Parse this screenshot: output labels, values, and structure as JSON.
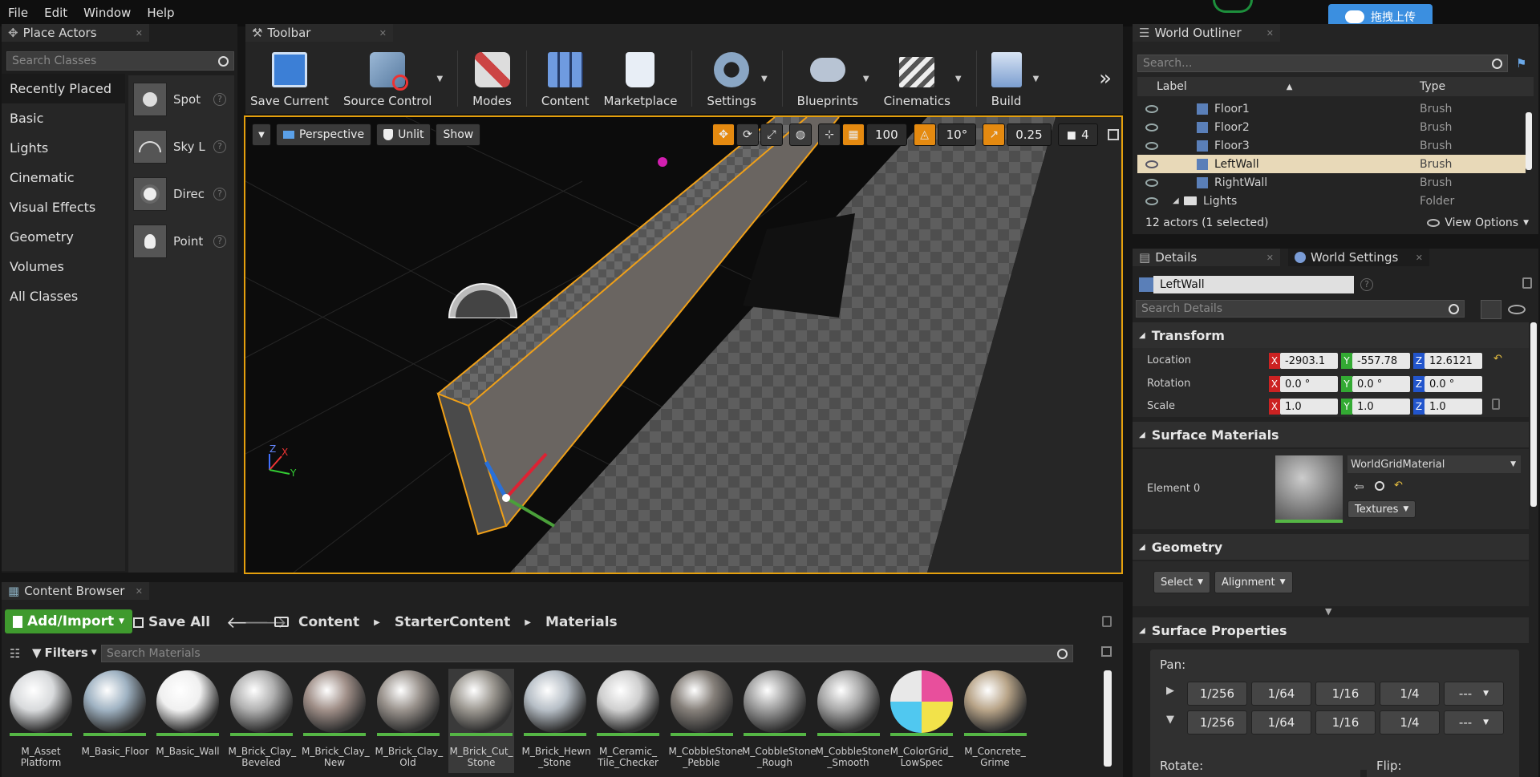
{
  "menu": [
    "File",
    "Edit",
    "Window",
    "Help"
  ],
  "upload_button": "拖拽上传",
  "place_actors": {
    "title": "Place Actors",
    "search_placeholder": "Search Classes",
    "categories": [
      "Recently Placed",
      "Basic",
      "Lights",
      "Cinematic",
      "Visual Effects",
      "Geometry",
      "Volumes",
      "All Classes"
    ],
    "actors": [
      "Spot",
      "Sky L",
      "Direc",
      "Point"
    ]
  },
  "toolbar": {
    "title": "Toolbar",
    "buttons": [
      "Save Current",
      "Source Control",
      "Modes",
      "Content",
      "Marketplace",
      "Settings",
      "Blueprints",
      "Cinematics",
      "Build"
    ]
  },
  "viewport": {
    "perspective": "Perspective",
    "unlit": "Unlit",
    "show": "Show",
    "grid_size": "100",
    "rotation_snap": "10°",
    "scale_snap": "0.25",
    "camera_speed": "4"
  },
  "outliner": {
    "title": "World Outliner",
    "search_placeholder": "Search...",
    "col_label": "Label",
    "col_type": "Type",
    "rows": [
      {
        "label": "Floor1",
        "type": "Brush"
      },
      {
        "label": "Floor2",
        "type": "Brush"
      },
      {
        "label": "Floor3",
        "type": "Brush"
      },
      {
        "label": "LeftWall",
        "type": "Brush"
      },
      {
        "label": "RightWall",
        "type": "Brush"
      },
      {
        "label": "Lights",
        "type": "Folder"
      }
    ],
    "status": "12 actors (1 selected)",
    "view_options": "View Options"
  },
  "details": {
    "tab_details": "Details",
    "tab_world_settings": "World Settings",
    "name_value": "LeftWall",
    "search_placeholder": "Search Details",
    "transform": "Transform",
    "location_label": "Location",
    "rotation_label": "Rotation",
    "scale_label": "Scale",
    "location": [
      "-2903.1",
      "-557.78",
      "12.6121"
    ],
    "rotation": [
      "0.0 °",
      "0.0 °",
      "0.0 °"
    ],
    "scale": [
      "1.0",
      "1.0",
      "1.0"
    ],
    "surface_materials": "Surface Materials",
    "element_label": "Element 0",
    "material_name": "WorldGridMaterial",
    "textures": "Textures",
    "geometry": "Geometry",
    "select_btn": "Select",
    "alignment_btn": "Alignment",
    "surface_properties": "Surface Properties",
    "pan_label": "Pan:",
    "pan_values": [
      "1/256",
      "1/64",
      "1/16",
      "1/4",
      "---"
    ],
    "rotate_label": "Rotate:",
    "flip_label": "Flip:"
  },
  "content_browser": {
    "title": "Content Browser",
    "add_import": "Add/Import",
    "save_all": "Save All",
    "path": [
      "Content",
      "StarterContent",
      "Materials"
    ],
    "filters": "Filters",
    "search_placeholder": "Search Materials",
    "materials": [
      {
        "name": "M_Asset Platform",
        "color": "#d8dadc"
      },
      {
        "name": "M_Basic_Floor",
        "color": "#9fb2c2"
      },
      {
        "name": "M_Basic_Wall",
        "color": "#f0f0f0"
      },
      {
        "name": "M_Brick_Clay_ Beveled",
        "color": "#b0b0b0"
      },
      {
        "name": "M_Brick_Clay_ New",
        "color": "#a08f88"
      },
      {
        "name": "M_Brick_Clay_ Old",
        "color": "#9a938d"
      },
      {
        "name": "M_Brick_Cut_ Stone",
        "color": "#9c9891"
      },
      {
        "name": "M_Brick_Hewn _Stone",
        "color": "#b6bec6"
      },
      {
        "name": "M_Ceramic_ Tile_Checker",
        "color": "#cfcfcf"
      },
      {
        "name": "M_CobbleStone _Pebble",
        "color": "#86807a"
      },
      {
        "name": "M_CobbleStone _Rough",
        "color": "#9c9c9c"
      },
      {
        "name": "M_CobbleStone _Smooth",
        "color": "#a8a8a8"
      },
      {
        "name": "M_ColorGrid_ LowSpec",
        "color": "#e8d040"
      },
      {
        "name": "M_Concrete_ Grime",
        "color": "#b8a488"
      }
    ]
  }
}
